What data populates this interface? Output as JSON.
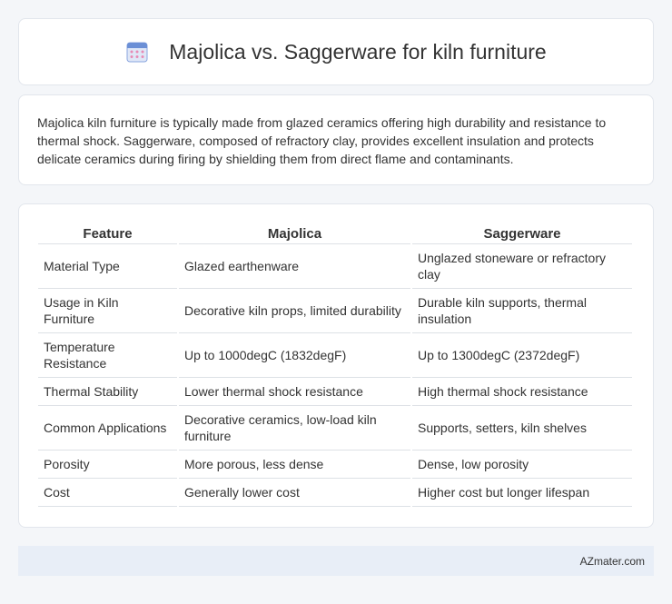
{
  "header": {
    "title": "Majolica vs. Saggerware for kiln furniture",
    "icon": "calendar-grid-icon"
  },
  "summary": {
    "text": "Majolica kiln furniture is typically made from glazed ceramics offering high durability and resistance to thermal shock. Saggerware, composed of refractory clay, provides excellent insulation and protects delicate ceramics during firing by shielding them from direct flame and contaminants."
  },
  "table": {
    "headers": [
      "Feature",
      "Majolica",
      "Saggerware"
    ],
    "rows": [
      [
        "Material Type",
        "Glazed earthenware",
        "Unglazed stoneware or refractory clay"
      ],
      [
        "Usage in Kiln Furniture",
        "Decorative kiln props, limited durability",
        "Durable kiln supports, thermal insulation"
      ],
      [
        "Temperature Resistance",
        "Up to 1000degC (1832degF)",
        "Up to 1300degC (2372degF)"
      ],
      [
        "Thermal Stability",
        "Lower thermal shock resistance",
        "High thermal shock resistance"
      ],
      [
        "Common Applications",
        "Decorative ceramics, low-load kiln furniture",
        "Supports, setters, kiln shelves"
      ],
      [
        "Porosity",
        "More porous, less dense",
        "Dense, low porosity"
      ],
      [
        "Cost",
        "Generally lower cost",
        "Higher cost but longer lifespan"
      ]
    ]
  },
  "footer": {
    "brand": "AZmater.com"
  },
  "colors": {
    "page_background": "#f4f6f9",
    "card_background": "#ffffff",
    "footer_background": "#e8eef7",
    "icon_blue": "#6b8fd6",
    "icon_pink": "#e88ab5"
  }
}
